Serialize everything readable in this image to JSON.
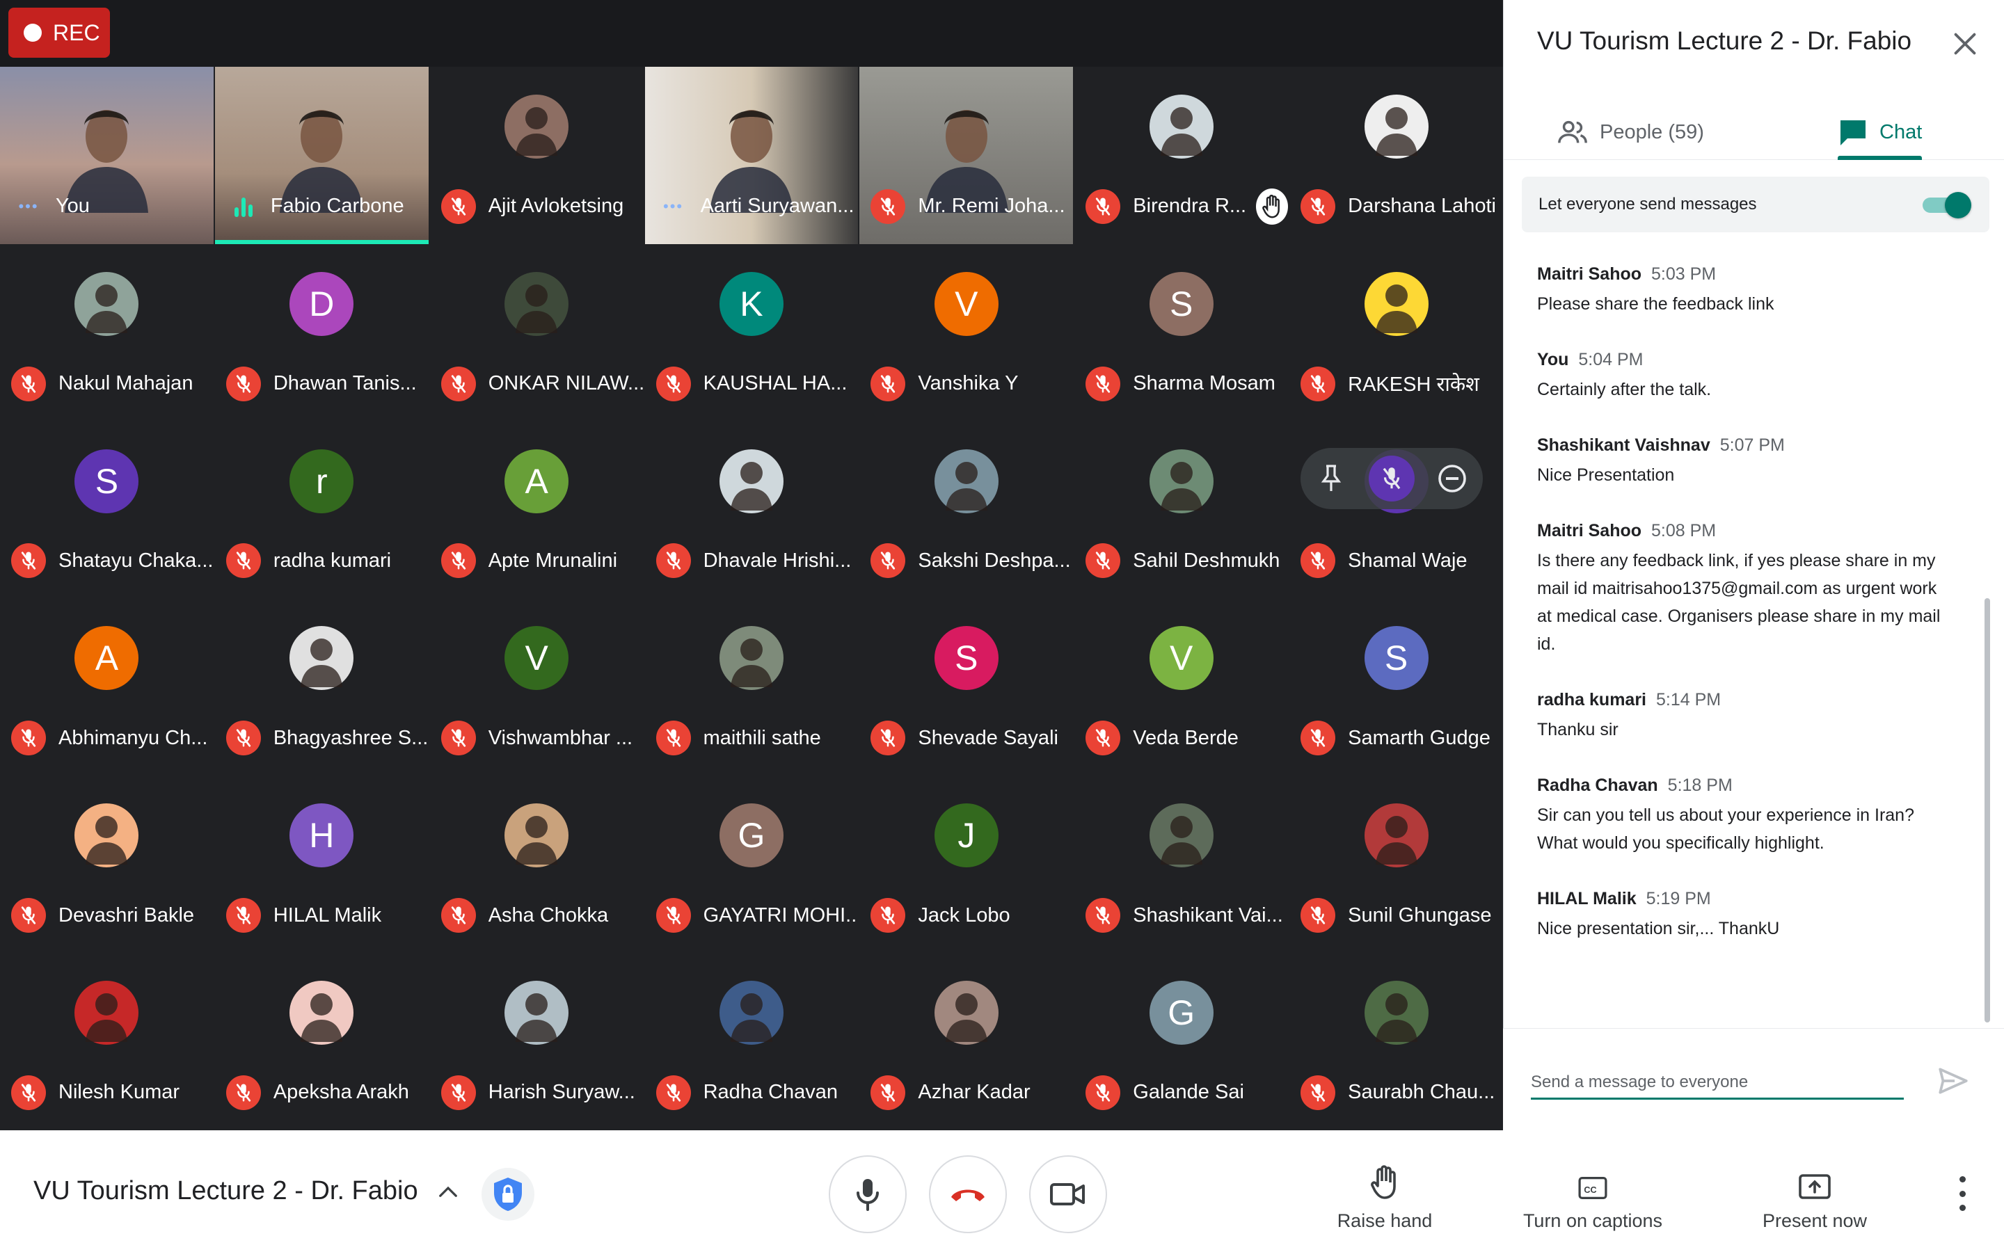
{
  "recording": {
    "label": "REC"
  },
  "meeting": {
    "title": "VU Tourism Lecture 2 - Dr. Fabio"
  },
  "colors": {
    "accent": "#00796b",
    "mic_off": "#ea4335",
    "speaking": "#1de9b6"
  },
  "participants": [
    {
      "name": "You",
      "status": "talking",
      "video": true,
      "bg": "linear-gradient(180deg,#8a8fa8 0%,#b89a8e 55%,#6b5a57 100%)"
    },
    {
      "name": "Fabio Carbone",
      "status": "speaking",
      "video": true,
      "bg": "linear-gradient(180deg,#b8a89a 0%,#a58e7c 60%,#5c4c45 100%)"
    },
    {
      "name": "Ajit Avloketsing",
      "status": "muted",
      "avatar_color": "#8d6e63",
      "avatar_icon": "person-photo"
    },
    {
      "name": "Aarti Suryawan...",
      "status": "talking",
      "video": true,
      "bg": "linear-gradient(90deg,#e8e4df 0%,#d6c9b5 50%,#3a3a3a 100%)"
    },
    {
      "name": "Mr. Remi Joha...",
      "status": "muted",
      "video": true,
      "bg": "linear-gradient(180deg,#9a9a94 0%,#6e6c68 100%)"
    },
    {
      "name": "Birendra R...",
      "status": "muted",
      "avatar_color": "#cfd8dc",
      "avatar_icon": "person-photo",
      "hand_raised": true
    },
    {
      "name": "Darshana Lahoti",
      "status": "muted",
      "avatar_color": "#eeeeee",
      "avatar_icon": "person-photo"
    },
    {
      "name": "Nakul Mahajan",
      "status": "muted",
      "avatar_color": "#8fa39a",
      "avatar_icon": "person-photo"
    },
    {
      "name": "Dhawan Tanis...",
      "status": "muted",
      "avatar_color": "#ab47bc",
      "initial": "D"
    },
    {
      "name": "ONKAR NILAW...",
      "status": "muted",
      "avatar_color": "#3e4a3a",
      "avatar_icon": "person-photo"
    },
    {
      "name": "KAUSHAL HA...",
      "status": "muted",
      "avatar_color": "#00897b",
      "initial": "K"
    },
    {
      "name": "Vanshika Y",
      "status": "muted",
      "avatar_color": "#ef6c00",
      "initial": "V"
    },
    {
      "name": "Sharma Mosam",
      "status": "muted",
      "avatar_color": "#8d6e63",
      "initial": "S"
    },
    {
      "name": "RAKESH राकेश",
      "status": "muted",
      "avatar_color": "#fdd835",
      "avatar_icon": "person-photo"
    },
    {
      "name": "Shatayu Chaka...",
      "status": "muted",
      "avatar_color": "#5e35b1",
      "initial": "S"
    },
    {
      "name": "radha kumari",
      "status": "muted",
      "avatar_color": "#33691e",
      "initial": "r"
    },
    {
      "name": "Apte Mrunalini",
      "status": "muted",
      "avatar_color": "#689f38",
      "initial": "A"
    },
    {
      "name": "Dhavale Hrishi...",
      "status": "muted",
      "avatar_color": "#cfd8dc",
      "avatar_icon": "person-photo"
    },
    {
      "name": "Sakshi Deshpa...",
      "status": "muted",
      "avatar_color": "#78909c",
      "avatar_icon": "person-photo"
    },
    {
      "name": "Sahil Deshmukh",
      "status": "muted",
      "avatar_color": "#6d8b74",
      "avatar_icon": "person-photo"
    },
    {
      "name": "Shamal Waje",
      "status": "muted",
      "avatar_color": "#5e35b1",
      "initial": "S",
      "hover_controls": true
    },
    {
      "name": "Abhimanyu Ch...",
      "status": "muted",
      "avatar_color": "#ef6c00",
      "initial": "A"
    },
    {
      "name": "Bhagyashree S...",
      "status": "muted",
      "avatar_color": "#e0e0e0",
      "avatar_icon": "person-photo"
    },
    {
      "name": "Vishwambhar ...",
      "status": "muted",
      "avatar_color": "#33691e",
      "initial": "V"
    },
    {
      "name": "maithili sathe",
      "status": "muted",
      "avatar_color": "#7e8b7a",
      "avatar_icon": "person-photo"
    },
    {
      "name": "Shevade Sayali",
      "status": "muted",
      "avatar_color": "#d81b60",
      "initial": "S"
    },
    {
      "name": "Veda Berde",
      "status": "muted",
      "avatar_color": "#7cb342",
      "initial": "V"
    },
    {
      "name": "Samarth Gudge",
      "status": "muted",
      "avatar_color": "#5c6bc0",
      "initial": "S"
    },
    {
      "name": "Devashri Bakle",
      "status": "muted",
      "avatar_color": "#f4b183",
      "avatar_icon": "person-photo"
    },
    {
      "name": "HILAL Malik",
      "status": "muted",
      "avatar_color": "#7e57c2",
      "initial": "H"
    },
    {
      "name": "Asha Chokka",
      "status": "muted",
      "avatar_color": "#c9a27c",
      "avatar_icon": "person-photo"
    },
    {
      "name": "GAYATRI MOHI...",
      "status": "muted",
      "avatar_color": "#8d6e63",
      "initial": "G"
    },
    {
      "name": "Jack Lobo",
      "status": "muted",
      "avatar_color": "#33691e",
      "initial": "J"
    },
    {
      "name": "Shashikant Vai...",
      "status": "muted",
      "avatar_color": "#5d6b5a",
      "avatar_icon": "person-photo"
    },
    {
      "name": "Sunil Ghungase",
      "status": "muted",
      "avatar_color": "#b23a3a",
      "avatar_icon": "person-photo"
    },
    {
      "name": "Nilesh Kumar",
      "status": "muted",
      "avatar_color": "#c62828",
      "avatar_icon": "person-photo"
    },
    {
      "name": "Apeksha Arakh",
      "status": "muted",
      "avatar_color": "#f0c9c2",
      "avatar_icon": "person-photo"
    },
    {
      "name": "Harish Suryaw...",
      "status": "muted",
      "avatar_color": "#b0bec5",
      "avatar_icon": "person-photo"
    },
    {
      "name": "Radha Chavan",
      "status": "muted",
      "avatar_color": "#3e5c8a",
      "avatar_icon": "person-photo"
    },
    {
      "name": "Azhar Kadar",
      "status": "muted",
      "avatar_color": "#a1887f",
      "avatar_icon": "person-photo"
    },
    {
      "name": "Galande Sai",
      "status": "muted",
      "avatar_color": "#78909c",
      "initial": "G"
    },
    {
      "name": "Saurabh Chau...",
      "status": "muted",
      "avatar_color": "#4e6b45",
      "avatar_icon": "person-photo"
    }
  ],
  "panel": {
    "title": "VU Tourism Lecture 2 - Dr. Fabio",
    "close_icon": "close-icon",
    "tabs": [
      {
        "label": "People (59)",
        "icon": "people-icon"
      },
      {
        "label": "Chat",
        "icon": "chat-icon",
        "active": true
      }
    ],
    "allow_messages_label": "Let everyone send messages",
    "allow_messages_on": true,
    "messages": [
      {
        "sender": "Maitri Sahoo",
        "time": "5:03 PM",
        "text": "Please share the feedback link"
      },
      {
        "sender": "You",
        "time": "5:04 PM",
        "text": "Certainly after the talk."
      },
      {
        "sender": "Shashikant Vaishnav",
        "time": "5:07 PM",
        "text": "Nice Presentation"
      },
      {
        "sender": "Maitri Sahoo",
        "time": "5:08 PM",
        "text": "Is there any feedback link, if yes please share in my mail id maitrisahoo1375@gmail.com as urgent work at medical case. Organisers please share in my mail id."
      },
      {
        "sender": "radha kumari",
        "time": "5:14 PM",
        "text": "Thanku sir"
      },
      {
        "sender": "Radha Chavan",
        "time": "5:18 PM",
        "text": "Sir can you tell us about your experience in Iran? What would you specifically highlight."
      },
      {
        "sender": "HILAL Malik",
        "time": "5:19 PM",
        "text": "Nice presentation sir,... ThankU"
      }
    ],
    "compose_placeholder": "Send a message to everyone",
    "compose_value": ""
  },
  "bottombar": {
    "meeting_name": "VU Tourism Lecture 2 - Dr. Fabio",
    "raise_hand": "Raise hand",
    "captions": "Turn on captions",
    "present": "Present now"
  }
}
